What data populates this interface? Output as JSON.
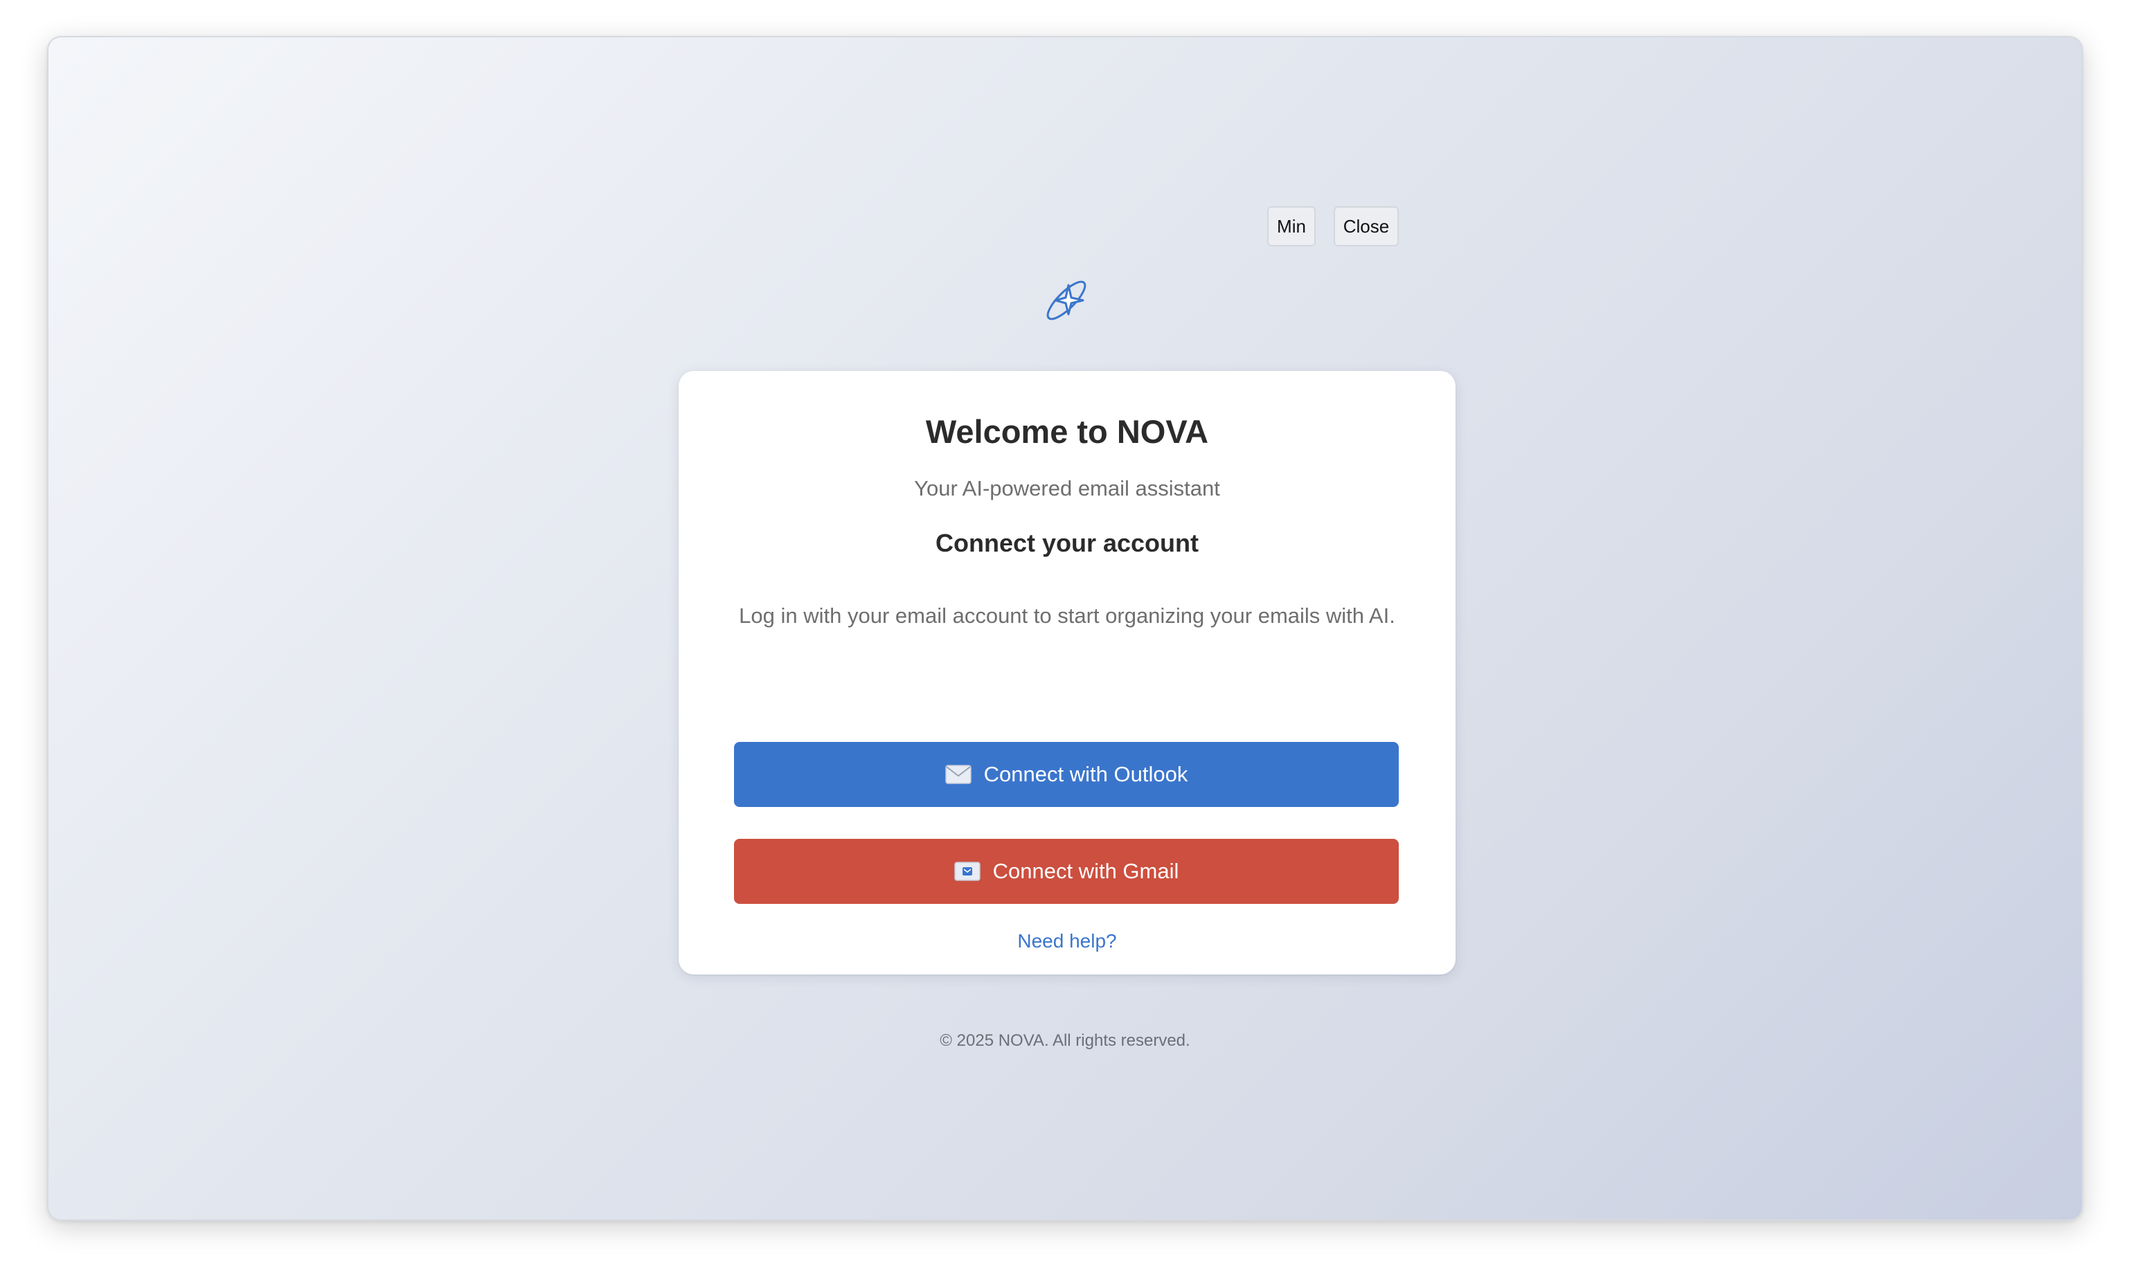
{
  "window": {
    "min_label": "Min",
    "close_label": "Close"
  },
  "logo": {
    "icon": "sparkle-orbit-icon",
    "color": "#3a75cc"
  },
  "card": {
    "title": "Welcome to NOVA",
    "subtitle": "Your AI-powered email assistant",
    "section_title": "Connect your account",
    "description": "Log in with your email account to start organizing your emails with AI.",
    "outlook_button": {
      "icon": "envelope-icon",
      "label": "Connect with Outlook",
      "color": "#3a75cc"
    },
    "gmail_button": {
      "icon": "email-icon",
      "label": "Connect with Gmail",
      "color": "#cc4f3f"
    },
    "help_link": "Need help?"
  },
  "footer": "© 2025 NOVA. All rights reserved."
}
